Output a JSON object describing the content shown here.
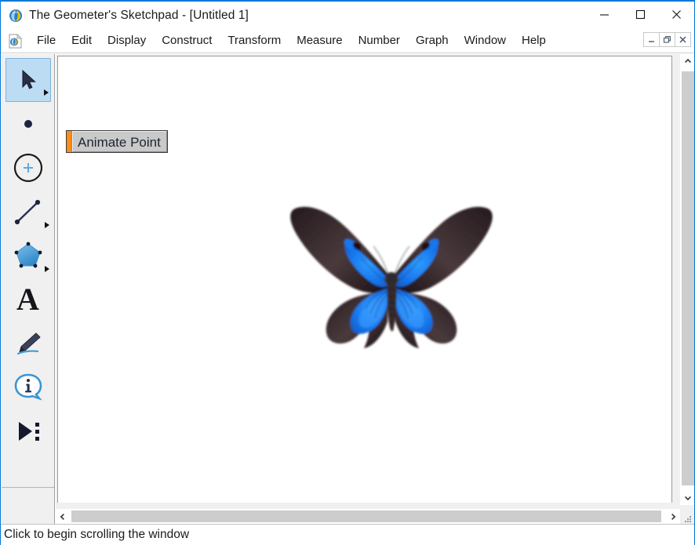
{
  "window": {
    "title": "The Geometer's Sketchpad - [Untitled 1]",
    "app_icon": "sketchpad-logo-icon",
    "controls": {
      "minimize_label": "Minimize",
      "maximize_label": "Maximize",
      "close_label": "Close"
    }
  },
  "menubar": {
    "doc_icon": "sketchpad-document-icon",
    "items": [
      {
        "label": "File"
      },
      {
        "label": "Edit"
      },
      {
        "label": "Display"
      },
      {
        "label": "Construct"
      },
      {
        "label": "Transform"
      },
      {
        "label": "Measure"
      },
      {
        "label": "Number"
      },
      {
        "label": "Graph"
      },
      {
        "label": "Window"
      },
      {
        "label": "Help"
      }
    ],
    "mdi_controls": {
      "minimize_label": "Minimize Document",
      "restore_label": "Restore Document",
      "close_label": "Close Document"
    }
  },
  "toolbar": {
    "tools": [
      {
        "name": "arrow-select-tool",
        "icon": "arrow-cursor-icon",
        "selected": true,
        "has_menu": true
      },
      {
        "name": "point-tool",
        "icon": "point-dot-icon",
        "selected": false,
        "has_menu": false
      },
      {
        "name": "compass-tool",
        "icon": "circle-compass-icon",
        "selected": false,
        "has_menu": false
      },
      {
        "name": "straightedge-tool",
        "icon": "segment-line-icon",
        "selected": false,
        "has_menu": true
      },
      {
        "name": "polygon-tool",
        "icon": "pentagon-icon",
        "selected": false,
        "has_menu": true
      },
      {
        "name": "text-tool",
        "icon": "text-A-icon",
        "selected": false,
        "has_menu": false
      },
      {
        "name": "marker-tool",
        "icon": "pen-marker-icon",
        "selected": false,
        "has_menu": false
      },
      {
        "name": "information-tool",
        "icon": "info-balloon-icon",
        "selected": false,
        "has_menu": false
      },
      {
        "name": "custom-tool",
        "icon": "play-triangle-menu-icon",
        "selected": false,
        "has_menu": false
      }
    ]
  },
  "sketch": {
    "animate_button": {
      "label": "Animate Point",
      "marker_color": "#ff8c18",
      "face_color": "#c9c9c9"
    },
    "image": {
      "name": "blue-ulysses-butterfly-image",
      "alt": "Blue Ulysses butterfly with black-tipped wings",
      "colors": {
        "wing_blue": "#1878ee",
        "wing_blue_light": "#3e9cff",
        "wing_dark": "#1a1016",
        "wing_brown": "#4a3a3c",
        "body": "#3a3438"
      }
    }
  },
  "scrollbars": {
    "vertical": {
      "up_label": "Scroll Up",
      "down_label": "Scroll Down"
    },
    "horizontal": {
      "left_label": "Scroll Left",
      "right_label": "Scroll Right"
    },
    "resize_grip_label": "Resize Window"
  },
  "statusbar": {
    "text": "Click to begin scrolling the window"
  },
  "theme": {
    "accent": "#0078d7",
    "toolbar_bg": "#f0f0f0",
    "selection_bg": "#bcdcf4",
    "selection_border": "#7eb4dd",
    "scrollbar_thumb": "#cdcdcd"
  }
}
